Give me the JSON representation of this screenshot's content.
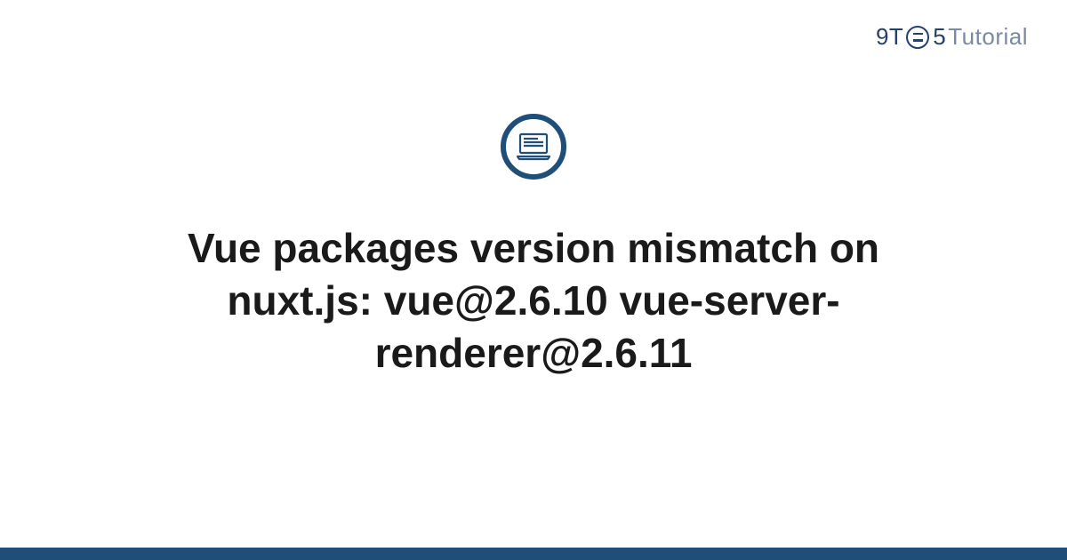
{
  "logo": {
    "left": "9T",
    "right": "5",
    "tutorial": "Tutorial"
  },
  "title": "Vue packages version mismatch on nuxt.js: vue@2.6.10 vue-server-renderer@2.6.11",
  "colors": {
    "brand": "#1f4e79",
    "logoText": "#25416b",
    "logoSecondary": "#7a8aa0"
  }
}
